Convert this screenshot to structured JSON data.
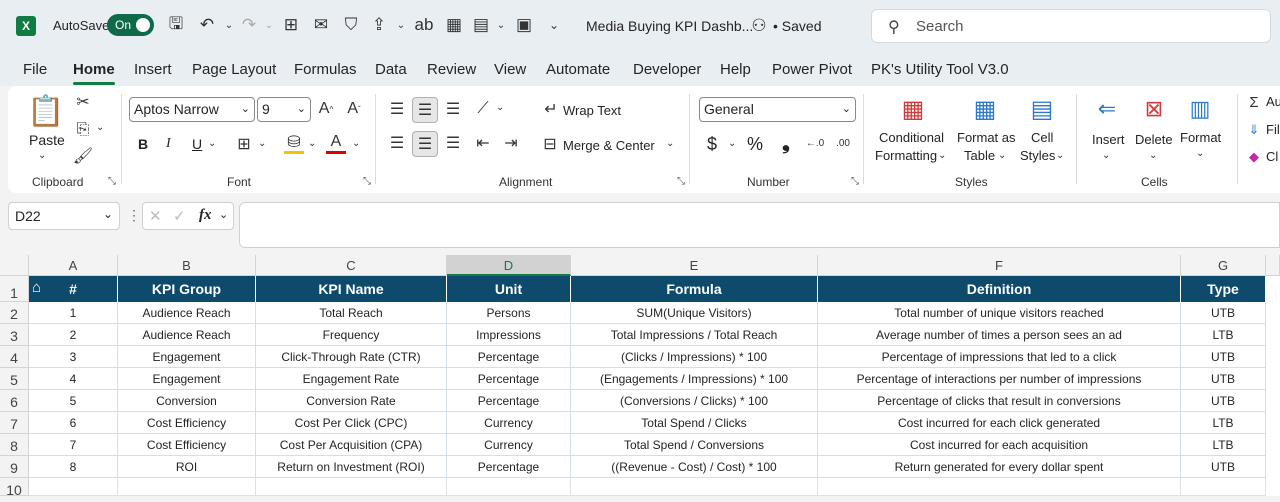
{
  "titlebar": {
    "autosave_label": "AutoSave",
    "autosave_state": "On",
    "doc_title": "Media Buying KPI Dashb...",
    "saved_status": "• Saved",
    "search_placeholder": "Search"
  },
  "menu": [
    "File",
    "Home",
    "Insert",
    "Page Layout",
    "Formulas",
    "Data",
    "Review",
    "View",
    "Automate",
    "Developer",
    "Help",
    "Power Pivot",
    "PK's Utility Tool V3.0"
  ],
  "ribbon": {
    "clipboard": {
      "paste": "Paste",
      "label": "Clipboard"
    },
    "font": {
      "name": "Aptos Narrow",
      "size": "9",
      "label": "Font",
      "bold": "B",
      "italic": "I",
      "underline": "U"
    },
    "alignment": {
      "wrap_text": "Wrap Text",
      "merge_center": "Merge & Center",
      "label": "Alignment"
    },
    "number": {
      "format": "General",
      "label": "Number",
      "currency": "$",
      "percent": "%",
      "comma": "❟"
    },
    "styles": {
      "conditional_formatting_1": "Conditional",
      "conditional_formatting_2": "Formatting",
      "format_as_table_1": "Format as",
      "format_as_table_2": "Table",
      "cell_styles_1": "Cell",
      "cell_styles_2": "Styles",
      "label": "Styles"
    },
    "cells": {
      "insert": "Insert",
      "delete": "Delete",
      "format": "Format",
      "label": "Cells"
    },
    "editing": {
      "autosum": "Au",
      "fill": "Fil",
      "clear": "Cl"
    }
  },
  "formula_bar": {
    "name_box": "D22",
    "fx": "fx",
    "content": ""
  },
  "columns": [
    "A",
    "B",
    "C",
    "D",
    "E",
    "F",
    "G"
  ],
  "rows": [
    "1",
    "2",
    "3",
    "4",
    "5",
    "6",
    "7",
    "8",
    "9",
    "10"
  ],
  "table": {
    "headers": [
      "#",
      "KPI Group",
      "KPI Name",
      "Unit",
      "Formula",
      "Definition",
      "Type"
    ],
    "rows": [
      [
        "1",
        "Audience Reach",
        "Total Reach",
        "Persons",
        "SUM(Unique Visitors)",
        "Total number of unique visitors reached",
        "UTB"
      ],
      [
        "2",
        "Audience Reach",
        "Frequency",
        "Impressions",
        "Total Impressions / Total Reach",
        "Average number of times a person sees an ad",
        "LTB"
      ],
      [
        "3",
        "Engagement",
        "Click-Through Rate (CTR)",
        "Percentage",
        "(Clicks / Impressions) * 100",
        "Percentage of impressions that led to a click",
        "UTB"
      ],
      [
        "4",
        "Engagement",
        "Engagement Rate",
        "Percentage",
        "(Engagements / Impressions) * 100",
        "Percentage of interactions per number of impressions",
        "UTB"
      ],
      [
        "5",
        "Conversion",
        "Conversion Rate",
        "Percentage",
        "(Conversions / Clicks) * 100",
        "Percentage of clicks that result in conversions",
        "UTB"
      ],
      [
        "6",
        "Cost Efficiency",
        "Cost Per Click (CPC)",
        "Currency",
        "Total Spend / Clicks",
        "Cost incurred for each click generated",
        "LTB"
      ],
      [
        "7",
        "Cost Efficiency",
        "Cost Per Acquisition (CPA)",
        "Currency",
        "Total Spend / Conversions",
        "Cost incurred for each acquisition",
        "LTB"
      ],
      [
        "8",
        "ROI",
        "Return on Investment (ROI)",
        "Percentage",
        "((Revenue - Cost) / Cost) * 100",
        "Return generated for every dollar spent",
        "UTB"
      ]
    ]
  },
  "colors": {
    "header_bg": "#0e4a6b",
    "accent": "#107c41"
  }
}
